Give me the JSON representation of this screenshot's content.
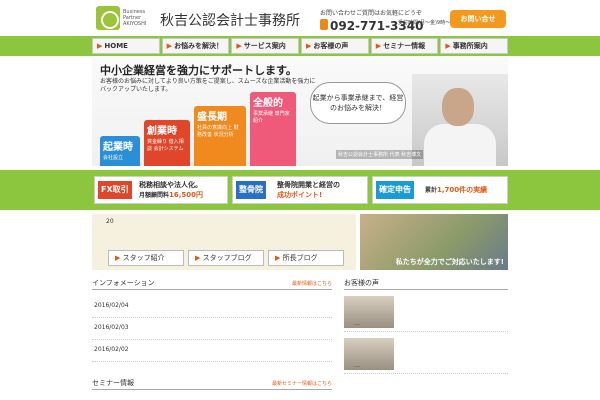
{
  "header": {
    "logo_sub": "Business Partner AKIYOSHI",
    "logo_title": "秋吉公認会計士事務所",
    "contact_label": "お問い合わせご質問はお気軽にどうぞ",
    "tel": "092-771-3340",
    "hours": "受付時間(月～金)9時～17時",
    "contact_button": "お問い合せ"
  },
  "nav": [
    {
      "label": "HOME"
    },
    {
      "label": "お悩みを解決！"
    },
    {
      "label": "サービス案内"
    },
    {
      "label": "お客様の声"
    },
    {
      "label": "セミナー情報"
    },
    {
      "label": "事務所案内"
    }
  ],
  "hero": {
    "title": "中小企業経営を強力にサポートします。",
    "desc": "お客様のお悩みに対してより良い方策をご提案し、スムーズな企業活動を強力にバックアップいたします。",
    "stairs": [
      {
        "title": "起業時",
        "desc": "会社設立",
        "color": "#2a8fd6"
      },
      {
        "title": "創業時",
        "desc": "資金繰り 借入相談 会計システム",
        "color": "#e0462a"
      },
      {
        "title": "盛長期",
        "desc": "社員の意識向上 財務改善 状況分析",
        "color": "#f08a1e"
      },
      {
        "title": "全般的",
        "desc": "事業承継 専門家紹介",
        "color": "#ef5a7a"
      }
    ],
    "bubble": "起業から事業承継まで、経営のお悩みを解決！",
    "caption": "秋吉公認会計士事務所 代表 秋吉博文"
  },
  "banners": [
    {
      "tag": "FX取引",
      "tag_color": "#e0462a",
      "line1": "税務相談や法人化。",
      "line2_pre": "月額顧問料",
      "line2_hl": "16,500円"
    },
    {
      "tag": "整骨院",
      "tag_color": "#2a6fc6",
      "line1": "整骨院開業と経営の",
      "line2_pre": "",
      "line2_hl": "成功ポイント!"
    },
    {
      "tag": "確定申告",
      "tag_color": "#1a9ad6",
      "line1": "",
      "line2_pre": "累計",
      "line2_hl": "1,700件の実績"
    }
  ],
  "beige": {
    "num": "20",
    "buttons": [
      {
        "label": "スタッフ紹介"
      },
      {
        "label": "スタッフブログ"
      },
      {
        "label": "所長ブログ"
      }
    ]
  },
  "team_caption": "私たちが全力でご対応いたします!",
  "info": {
    "title": "インフォメーション",
    "more": "最新情報はこちら",
    "dates": [
      "2016/02/04",
      "2016/02/03",
      "2016/02/02"
    ]
  },
  "seminar": {
    "title": "セミナー情報",
    "more": "最新セミナー情報はこちら"
  },
  "voice": {
    "title": "お客様の声",
    "items": [
      "…",
      "…"
    ]
  },
  "colors": {
    "green": "#8cc63f",
    "orange": "#f39a1e",
    "accent": "#e05a14"
  }
}
